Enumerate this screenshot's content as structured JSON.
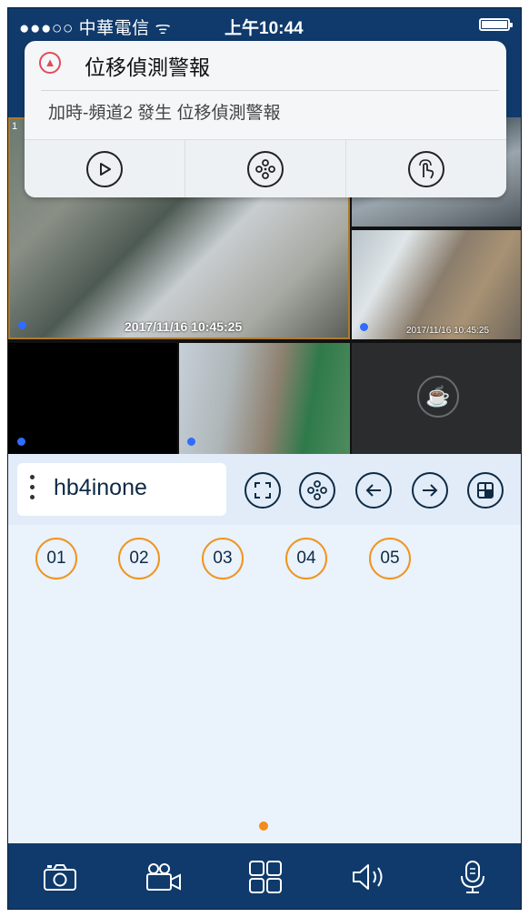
{
  "status": {
    "carrier": "●●●○○ 中華電信 ᯤ",
    "time": "上午10:44"
  },
  "notification": {
    "icon": "bell-icon",
    "title": "位移偵測警報",
    "body": "加時-頻道2 發生 位移偵測警報",
    "actions": [
      {
        "name": "play-icon"
      },
      {
        "name": "film-reel-icon"
      },
      {
        "name": "touch-icon"
      }
    ]
  },
  "cameras": {
    "main_index": "1",
    "main_timestamp": "2017/11/16 10:45:25",
    "r2_timestamp": "2017/11/16 10:45:25"
  },
  "device": {
    "name": "hb4inone"
  },
  "toolbar_icons": [
    "fullscreen-icon",
    "film-reel-icon",
    "arrow-left-icon",
    "arrow-right-icon",
    "layout-icon"
  ],
  "channels": [
    "01",
    "02",
    "03",
    "04",
    "05"
  ],
  "bottom_icons": [
    "camera-icon",
    "video-record-icon",
    "grid-icon",
    "speaker-icon",
    "microphone-icon"
  ],
  "colors": {
    "navy": "#0f3a6b",
    "accent_orange": "#f0941e",
    "dot_blue": "#2f6cff"
  }
}
